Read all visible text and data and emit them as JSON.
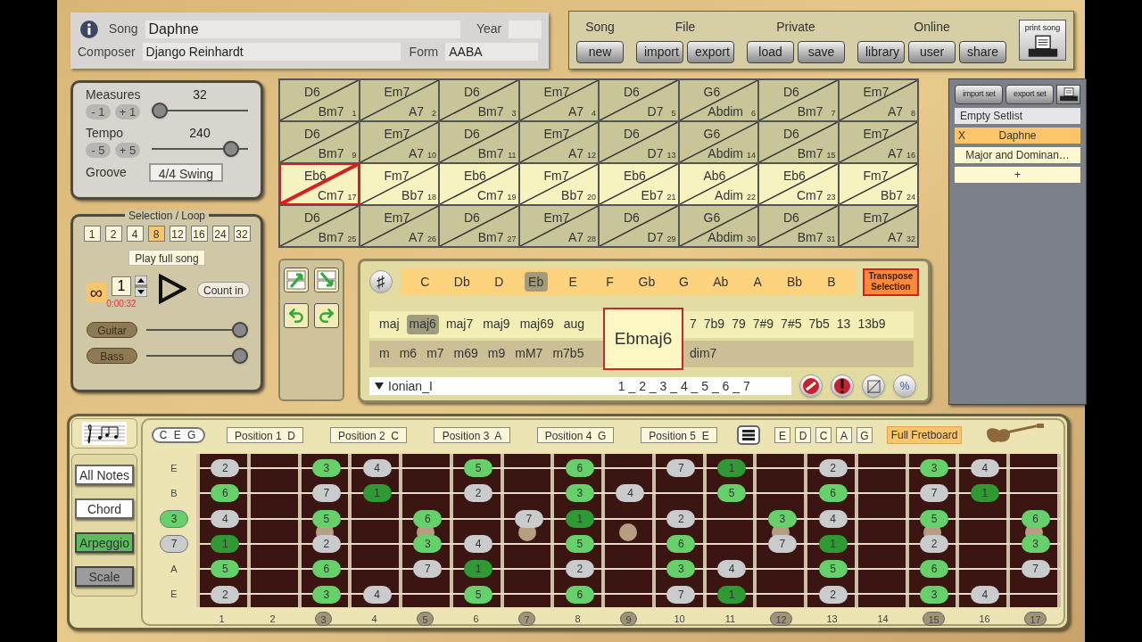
{
  "song_info": {
    "song_label": "Song",
    "song": "Daphne",
    "year_label": "Year",
    "composer_label": "Composer",
    "composer": "Django Reinhardt",
    "form_label": "Form",
    "form": "AABA"
  },
  "toolbar": {
    "groups": [
      {
        "label": "Song",
        "buttons": [
          "new"
        ]
      },
      {
        "label": "File",
        "buttons": [
          "import",
          "export"
        ]
      },
      {
        "label": "Private",
        "buttons": [
          "load",
          "save"
        ]
      },
      {
        "label": "Online",
        "buttons": [
          "library",
          "user",
          "share"
        ]
      }
    ],
    "print_label": "print song"
  },
  "measures": {
    "label": "Measures",
    "value": "32",
    "level": 0.08,
    "buttons": [
      "- 1",
      "+ 1"
    ]
  },
  "tempo": {
    "label": "Tempo",
    "value": "240",
    "level": 0.82,
    "buttons": [
      "- 5",
      "+ 5"
    ]
  },
  "groove": {
    "label": "Groove",
    "value": "4/4 Swing"
  },
  "chart": [
    {
      "top": "D6",
      "bottom": "Bm7",
      "number": "1",
      "selected": false,
      "current": false
    },
    {
      "top": "Em7",
      "bottom": "A7",
      "number": "2",
      "selected": false,
      "current": false
    },
    {
      "top": "D6",
      "bottom": "Bm7",
      "number": "3",
      "selected": false,
      "current": false
    },
    {
      "top": "Em7",
      "bottom": "A7",
      "number": "4",
      "selected": false,
      "current": false
    },
    {
      "top": "D6",
      "bottom": "D7",
      "number": "5",
      "selected": false,
      "current": false
    },
    {
      "top": "G6",
      "bottom": "Abdim",
      "number": "6",
      "selected": false,
      "current": false
    },
    {
      "top": "D6",
      "bottom": "Bm7",
      "number": "7",
      "selected": false,
      "current": false
    },
    {
      "top": "Em7",
      "bottom": "A7",
      "number": "8",
      "selected": false,
      "current": false
    },
    {
      "top": "D6",
      "bottom": "Bm7",
      "number": "9",
      "selected": false,
      "current": false
    },
    {
      "top": "Em7",
      "bottom": "A7",
      "number": "10",
      "selected": false,
      "current": false
    },
    {
      "top": "D6",
      "bottom": "Bm7",
      "number": "11",
      "selected": false,
      "current": false
    },
    {
      "top": "Em7",
      "bottom": "A7",
      "number": "12",
      "selected": false,
      "current": false
    },
    {
      "top": "D6",
      "bottom": "D7",
      "number": "13",
      "selected": false,
      "current": false
    },
    {
      "top": "G6",
      "bottom": "Abdim",
      "number": "14",
      "selected": false,
      "current": false
    },
    {
      "top": "D6",
      "bottom": "Bm7",
      "number": "15",
      "selected": false,
      "current": false
    },
    {
      "top": "Em7",
      "bottom": "A7",
      "number": "16",
      "selected": false,
      "current": false
    },
    {
      "top": "Eb6",
      "bottom": "Cm7",
      "number": "17",
      "selected": true,
      "current": true
    },
    {
      "top": "Fm7",
      "bottom": "Bb7",
      "number": "18",
      "selected": true,
      "current": false
    },
    {
      "top": "Eb6",
      "bottom": "Cm7",
      "number": "19",
      "selected": true,
      "current": false
    },
    {
      "top": "Fm7",
      "bottom": "Bb7",
      "number": "20",
      "selected": true,
      "current": false
    },
    {
      "top": "Eb6",
      "bottom": "Eb7",
      "number": "21",
      "selected": true,
      "current": false
    },
    {
      "top": "Ab6",
      "bottom": "Adim",
      "number": "22",
      "selected": true,
      "current": false
    },
    {
      "top": "Eb6",
      "bottom": "Cm7",
      "number": "23",
      "selected": true,
      "current": false
    },
    {
      "top": "Fm7",
      "bottom": "Bb7",
      "number": "24",
      "selected": true,
      "current": false
    },
    {
      "top": "D6",
      "bottom": "Bm7",
      "number": "25",
      "selected": false,
      "current": false
    },
    {
      "top": "Em7",
      "bottom": "A7",
      "number": "26",
      "selected": false,
      "current": false
    },
    {
      "top": "D6",
      "bottom": "Bm7",
      "number": "27",
      "selected": false,
      "current": false
    },
    {
      "top": "Em7",
      "bottom": "A7",
      "number": "28",
      "selected": false,
      "current": false
    },
    {
      "top": "D6",
      "bottom": "D7",
      "number": "29",
      "selected": false,
      "current": false
    },
    {
      "top": "G6",
      "bottom": "Abdim",
      "number": "30",
      "selected": false,
      "current": false
    },
    {
      "top": "D6",
      "bottom": "Bm7",
      "number": "31",
      "selected": false,
      "current": false
    },
    {
      "top": "Em7",
      "bottom": "A7",
      "number": "32",
      "selected": false,
      "current": false
    }
  ],
  "setlist": {
    "buttons": [
      "import set",
      "export set"
    ],
    "items": [
      {
        "kind": "header",
        "label": "Empty Setlist",
        "selected": false
      },
      {
        "kind": "song",
        "label": "Daphne",
        "remove": "X",
        "selected": true
      },
      {
        "kind": "song",
        "label": "Major and Dominan…",
        "selected": false
      },
      {
        "kind": "add",
        "label": "+",
        "selected": false
      }
    ]
  },
  "loop": {
    "title": "Selection / Loop",
    "lengths": [
      {
        "label": "1",
        "selected": false
      },
      {
        "label": "2",
        "selected": false
      },
      {
        "label": "4",
        "selected": false
      },
      {
        "label": "8",
        "selected": true
      },
      {
        "label": "12",
        "selected": false
      },
      {
        "label": "16",
        "selected": false
      },
      {
        "label": "24",
        "selected": false
      },
      {
        "label": "32",
        "selected": false
      }
    ],
    "play_full": "Play full song",
    "repeat_symbol": "∞",
    "repeat_on": true,
    "count": "1",
    "time": "0:00:32",
    "count_in": "Count in"
  },
  "mixer": [
    {
      "label": "Guitar",
      "level": 0.95
    },
    {
      "label": "Bass",
      "level": 0.95
    }
  ],
  "editor": {
    "sharp": "♯",
    "roots": [
      {
        "label": "C",
        "selected": false
      },
      {
        "label": "Db",
        "selected": false
      },
      {
        "label": "D",
        "selected": false
      },
      {
        "label": "Eb",
        "selected": true
      },
      {
        "label": "E",
        "selected": false
      },
      {
        "label": "F",
        "selected": false
      },
      {
        "label": "Gb",
        "selected": false
      },
      {
        "label": "G",
        "selected": false
      },
      {
        "label": "Ab",
        "selected": false
      },
      {
        "label": "A",
        "selected": false
      },
      {
        "label": "Bb",
        "selected": false
      },
      {
        "label": "B",
        "selected": false
      }
    ],
    "transpose": "Transpose Selection",
    "major_qualities": [
      {
        "label": "maj",
        "selected": false
      },
      {
        "label": "maj6",
        "selected": true
      },
      {
        "label": "maj7",
        "selected": false
      },
      {
        "label": "maj9",
        "selected": false
      },
      {
        "label": "maj69",
        "selected": false
      },
      {
        "label": "aug",
        "selected": false
      }
    ],
    "minor_qualities": [
      {
        "label": "m",
        "selected": false
      },
      {
        "label": "m6",
        "selected": false
      },
      {
        "label": "m7",
        "selected": false
      },
      {
        "label": "m69",
        "selected": false
      },
      {
        "label": "m9",
        "selected": false
      },
      {
        "label": "mM7",
        "selected": false
      },
      {
        "label": "m7b5",
        "selected": false
      }
    ],
    "dominant_qualities": [
      {
        "label": "7",
        "selected": false
      },
      {
        "label": "7b9",
        "selected": false
      },
      {
        "label": "79",
        "selected": false
      },
      {
        "label": "7#9",
        "selected": false
      },
      {
        "label": "7#5",
        "selected": false
      },
      {
        "label": "7b5",
        "selected": false
      },
      {
        "label": "13",
        "selected": false
      },
      {
        "label": "13b9",
        "selected": false
      }
    ],
    "diminished_qualities": [
      {
        "label": "dim7",
        "selected": false
      }
    ],
    "chord": "Ebmaj6",
    "scale": "Ionian_I",
    "degrees": "1 _ 2 _ 3 _ 4 _ 5 _ 6 _ 7",
    "percent": "%"
  },
  "fretboard": {
    "chord_tones": "C E G",
    "positions": [
      "Position 1  D",
      "Position 2  C",
      "Position 3  A",
      "Position 4  G",
      "Position 5  E"
    ],
    "shapes": [
      "E",
      "D",
      "C",
      "A",
      "G"
    ],
    "full": {
      "label": "Full Fretboard",
      "selected": true
    },
    "modes": [
      {
        "label": "All Notes",
        "on": false
      },
      {
        "label": "Chord",
        "on": false
      },
      {
        "label": "Arpeggio",
        "on": true,
        "color": "#5cbc5c"
      },
      {
        "label": "Scale",
        "on": true,
        "color": "#9c9c9c"
      }
    ],
    "strings": [
      {
        "label": "E",
        "kind": "letter",
        "frets": [
          {
            "degree": "2",
            "kind": "scale"
          },
          {
            "kind": "empty"
          },
          {
            "degree": "3",
            "kind": "chord"
          },
          {
            "degree": "4",
            "kind": "scale"
          },
          {
            "kind": "empty"
          },
          {
            "degree": "5",
            "kind": "chord"
          },
          {
            "kind": "empty"
          },
          {
            "degree": "6",
            "kind": "chord"
          },
          {
            "kind": "empty"
          },
          {
            "degree": "7",
            "kind": "scale"
          },
          {
            "degree": "1",
            "kind": "root"
          },
          {
            "kind": "empty"
          },
          {
            "degree": "2",
            "kind": "scale"
          },
          {
            "kind": "empty"
          },
          {
            "degree": "3",
            "kind": "chord"
          },
          {
            "degree": "4",
            "kind": "scale"
          },
          {
            "kind": "empty"
          }
        ]
      },
      {
        "label": "B",
        "kind": "letter",
        "frets": [
          {
            "degree": "6",
            "kind": "chord"
          },
          {
            "kind": "empty"
          },
          {
            "degree": "7",
            "kind": "scale"
          },
          {
            "degree": "1",
            "kind": "root"
          },
          {
            "kind": "empty"
          },
          {
            "degree": "2",
            "kind": "scale"
          },
          {
            "kind": "empty"
          },
          {
            "degree": "3",
            "kind": "chord"
          },
          {
            "degree": "4",
            "kind": "scale"
          },
          {
            "kind": "empty"
          },
          {
            "degree": "5",
            "kind": "chord"
          },
          {
            "kind": "empty"
          },
          {
            "degree": "6",
            "kind": "chord"
          },
          {
            "kind": "empty"
          },
          {
            "degree": "7",
            "kind": "scale"
          },
          {
            "degree": "1",
            "kind": "root"
          },
          {
            "kind": "empty"
          }
        ]
      },
      {
        "label": "3",
        "kind": "chord",
        "frets": [
          {
            "degree": "4",
            "kind": "scale"
          },
          {
            "kind": "empty"
          },
          {
            "degree": "5",
            "kind": "chord"
          },
          {
            "kind": "empty"
          },
          {
            "degree": "6",
            "kind": "chord"
          },
          {
            "kind": "empty"
          },
          {
            "degree": "7",
            "kind": "scale"
          },
          {
            "degree": "1",
            "kind": "root"
          },
          {
            "kind": "empty"
          },
          {
            "degree": "2",
            "kind": "scale"
          },
          {
            "kind": "empty"
          },
          {
            "degree": "3",
            "kind": "chord"
          },
          {
            "degree": "4",
            "kind": "scale"
          },
          {
            "kind": "empty"
          },
          {
            "degree": "5",
            "kind": "chord"
          },
          {
            "kind": "empty"
          },
          {
            "degree": "6",
            "kind": "chord"
          }
        ]
      },
      {
        "label": "7",
        "kind": "scale",
        "frets": [
          {
            "degree": "1",
            "kind": "root"
          },
          {
            "kind": "empty"
          },
          {
            "degree": "2",
            "kind": "scale"
          },
          {
            "kind": "empty"
          },
          {
            "degree": "3",
            "kind": "chord"
          },
          {
            "degree": "4",
            "kind": "scale"
          },
          {
            "kind": "empty"
          },
          {
            "degree": "5",
            "kind": "chord"
          },
          {
            "kind": "empty"
          },
          {
            "degree": "6",
            "kind": "chord"
          },
          {
            "kind": "empty"
          },
          {
            "degree": "7",
            "kind": "scale"
          },
          {
            "degree": "1",
            "kind": "root"
          },
          {
            "kind": "empty"
          },
          {
            "degree": "2",
            "kind": "scale"
          },
          {
            "kind": "empty"
          },
          {
            "degree": "3",
            "kind": "chord"
          }
        ]
      },
      {
        "label": "A",
        "kind": "letter",
        "frets": [
          {
            "degree": "5",
            "kind": "chord"
          },
          {
            "kind": "empty"
          },
          {
            "degree": "6",
            "kind": "chord"
          },
          {
            "kind": "empty"
          },
          {
            "degree": "7",
            "kind": "scale"
          },
          {
            "degree": "1",
            "kind": "root"
          },
          {
            "kind": "empty"
          },
          {
            "degree": "2",
            "kind": "scale"
          },
          {
            "kind": "empty"
          },
          {
            "degree": "3",
            "kind": "chord"
          },
          {
            "degree": "4",
            "kind": "scale"
          },
          {
            "kind": "empty"
          },
          {
            "degree": "5",
            "kind": "chord"
          },
          {
            "kind": "empty"
          },
          {
            "degree": "6",
            "kind": "chord"
          },
          {
            "kind": "empty"
          },
          {
            "degree": "7",
            "kind": "scale"
          }
        ]
      },
      {
        "label": "E",
        "kind": "letter",
        "frets": [
          {
            "degree": "2",
            "kind": "scale"
          },
          {
            "kind": "empty"
          },
          {
            "degree": "3",
            "kind": "chord"
          },
          {
            "degree": "4",
            "kind": "scale"
          },
          {
            "kind": "empty"
          },
          {
            "degree": "5",
            "kind": "chord"
          },
          {
            "kind": "empty"
          },
          {
            "degree": "6",
            "kind": "chord"
          },
          {
            "kind": "empty"
          },
          {
            "degree": "7",
            "kind": "scale"
          },
          {
            "degree": "1",
            "kind": "root"
          },
          {
            "kind": "empty"
          },
          {
            "degree": "2",
            "kind": "scale"
          },
          {
            "kind": "empty"
          },
          {
            "degree": "3",
            "kind": "chord"
          },
          {
            "degree": "4",
            "kind": "scale"
          },
          {
            "kind": "empty"
          }
        ]
      }
    ],
    "fret_numbers": [
      {
        "label": "1",
        "marked": false
      },
      {
        "label": "2",
        "marked": false
      },
      {
        "label": "3",
        "marked": true
      },
      {
        "label": "4",
        "marked": false
      },
      {
        "label": "5",
        "marked": true
      },
      {
        "label": "6",
        "marked": false
      },
      {
        "label": "7",
        "marked": true
      },
      {
        "label": "8",
        "marked": false
      },
      {
        "label": "9",
        "marked": true
      },
      {
        "label": "10",
        "marked": false
      },
      {
        "label": "11",
        "marked": false
      },
      {
        "label": "12",
        "marked": true
      },
      {
        "label": "13",
        "marked": false
      },
      {
        "label": "14",
        "marked": false
      },
      {
        "label": "15",
        "marked": true
      },
      {
        "label": "16",
        "marked": false
      },
      {
        "label": "17",
        "marked": true
      }
    ]
  }
}
